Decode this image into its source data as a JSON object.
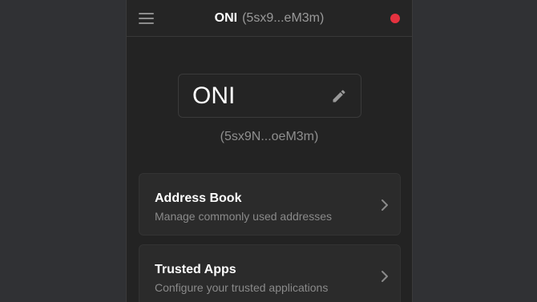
{
  "header": {
    "account_name": "ONI",
    "account_address_short": "(5sx9...eM3m)",
    "status_color": "#e5323f",
    "menu_icon": "hamburger-menu-icon"
  },
  "account": {
    "name": "ONI",
    "address": "(5sx9N...oeM3m)",
    "edit_icon": "pencil-icon"
  },
  "settings_items": [
    {
      "title": "Address Book",
      "subtitle": "Manage commonly used addresses",
      "icon": "chevron-right-icon"
    },
    {
      "title": "Trusted Apps",
      "subtitle": "Configure your trusted applications",
      "icon": "chevron-right-icon"
    }
  ]
}
